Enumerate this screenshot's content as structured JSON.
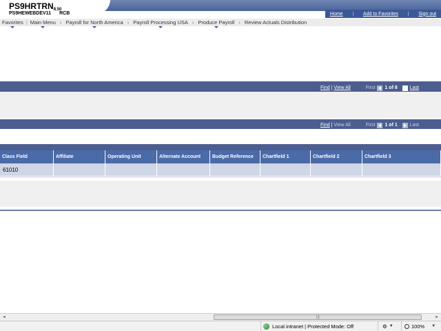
{
  "header": {
    "system_name": "PS9HRTRN",
    "version": "8.50",
    "server_name": "PS9HEWEBDEV11",
    "user_code": "RCB",
    "links": [
      "Home",
      "Add to Favorites",
      "Sign out"
    ]
  },
  "breadcrumb": {
    "items": [
      "Favorites",
      "Main Menu",
      "Payroll for North America",
      "Payroll Processing USA",
      "Produce Payroll",
      "Review Actuals Distribution"
    ]
  },
  "nav1": {
    "find": "Find",
    "view_all": "View All",
    "first": "First",
    "count": "1 of 8",
    "last": "Last"
  },
  "nav2": {
    "find": "Find",
    "view_all": "View All",
    "first": "First",
    "count": "1 of 1",
    "last": "Last"
  },
  "grid": {
    "columns": [
      "Class Field",
      "Affiliate",
      "Operating Unit",
      "Alternate Account",
      "Budget Reference",
      "Chartfield 1",
      "Chartfield 2",
      "Chartfield 3"
    ],
    "rows": [
      [
        "61010",
        "",
        "",
        "",
        "",
        "",
        "",
        ""
      ]
    ]
  },
  "statusbar": {
    "zone": "Local intranet | Protected Mode: Off",
    "zoom": "100%"
  },
  "colors": {
    "section_bar": "#4b5e8f",
    "grid_header": "#4a6aa8",
    "grid_row": "#cfd7e6",
    "link": "#3b5998"
  }
}
